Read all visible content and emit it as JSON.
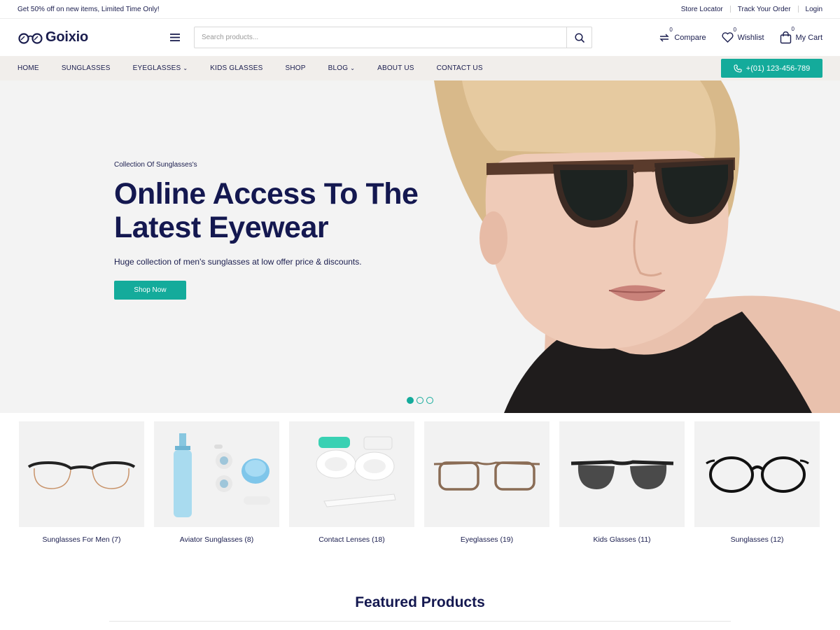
{
  "topbar": {
    "promo": "Get 50% off on new items, Limited Time Only!",
    "links": [
      "Store Locator",
      "Track Your Order",
      "Login"
    ]
  },
  "header": {
    "logo": "Goixio",
    "search_placeholder": "Search products...",
    "compare": {
      "label": "Compare",
      "count": "0"
    },
    "wishlist": {
      "label": "Wishlist",
      "count": "0"
    },
    "cart": {
      "label": "My Cart",
      "count": "0"
    }
  },
  "nav": {
    "items": [
      "HOME",
      "SUNGLASSES",
      "EYEGLASSES",
      "KIDS GLASSES",
      "SHOP",
      "BLOG",
      "ABOUT US",
      "CONTACT US"
    ],
    "phone": "+(01) 123-456-789"
  },
  "hero": {
    "subtitle": "Collection Of Sunglasses's",
    "title_line1": "Online Access To The",
    "title_line2": "Latest Eyewear",
    "description": "Huge collection of men's sunglasses at low offer price & discounts.",
    "button": "Shop Now",
    "slides": 3,
    "active_slide": 1
  },
  "categories": [
    {
      "label": "Sunglasses For Men (7)",
      "icon": "round-glasses-icon"
    },
    {
      "label": "Aviator Sunglasses (8)",
      "icon": "lens-care-kit-icon"
    },
    {
      "label": "Contact Lenses (18)",
      "icon": "contact-lens-case-icon"
    },
    {
      "label": "Eyeglasses (19)",
      "icon": "square-glasses-icon"
    },
    {
      "label": "Kids Glasses (11)",
      "icon": "sunglasses-icon"
    },
    {
      "label": "Sunglasses (12)",
      "icon": "round-black-glasses-icon"
    }
  ],
  "featured": {
    "title": "Featured Products"
  },
  "colors": {
    "accent": "#14ab9b",
    "navy": "#141850",
    "nav_bg": "#f1eeeb",
    "hero_bg": "#f3f3f3"
  }
}
